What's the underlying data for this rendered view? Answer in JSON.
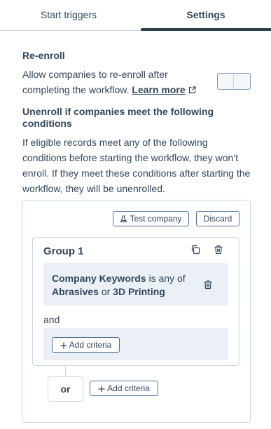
{
  "tabs": [
    {
      "label": "Start triggers",
      "active": false
    },
    {
      "label": "Settings",
      "active": true
    }
  ],
  "reenroll": {
    "heading": "Re-enroll",
    "description": "Allow companies to re-enroll after completing the workflow.",
    "link_label": "Learn more",
    "toggle_on": false
  },
  "unenroll": {
    "heading": "Unenroll if companies meet the following conditions",
    "description": "If eligible records meet any of the following conditions before starting the workflow, they won’t enroll. If they meet these conditions after starting the workflow, they will be unenrolled."
  },
  "filter_panel": {
    "test_button_label": "Test company",
    "discard_button_label": "Discard",
    "group": {
      "title": "Group 1",
      "criteria": {
        "property": "Company Keywords",
        "operator": "is any of",
        "value_1": "Abrasives",
        "joiner": "or",
        "value_2": "3D Printing"
      },
      "and_label": "and",
      "add_criteria_label": "Add criteria"
    },
    "or_label": "or",
    "add_criteria_label": "Add criteria"
  },
  "colors": {
    "text": "#33475b",
    "border": "#cbd6e2",
    "card_bg": "#eaf0f6",
    "tab_indicator": "#2d3e50"
  }
}
